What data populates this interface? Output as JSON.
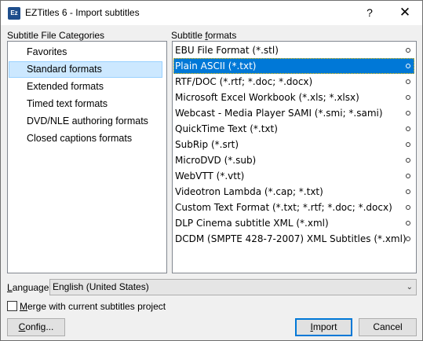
{
  "window": {
    "title": "EZTitles 6 - Import subtitles",
    "icon_text": "Ez",
    "help_glyph": "?",
    "close_glyph": "✕"
  },
  "categories": {
    "label_pre": "",
    "label_u": "",
    "label_post": "Subtitle File Categories",
    "items": [
      {
        "label": "Favorites"
      },
      {
        "label": "Standard formats"
      },
      {
        "label": "Extended formats"
      },
      {
        "label": "Timed text formats"
      },
      {
        "label": "DVD/NLE authoring formats"
      },
      {
        "label": "Closed captions formats"
      }
    ],
    "selected_index": 1
  },
  "formats": {
    "label_pre": "Subtitle ",
    "label_u": "f",
    "label_post": "ormats",
    "items": [
      {
        "label": "EBU File Format  (*.stl)"
      },
      {
        "label": "Plain ASCII  (*.txt)"
      },
      {
        "label": "RTF/DOC  (*.rtf; *.doc; *.docx)"
      },
      {
        "label": "Microsoft Excel Workbook  (*.xls; *.xlsx)"
      },
      {
        "label": "Webcast - Media Player SAMI  (*.smi; *.sami)"
      },
      {
        "label": "QuickTime Text  (*.txt)"
      },
      {
        "label": "SubRip  (*.srt)"
      },
      {
        "label": "MicroDVD  (*.sub)"
      },
      {
        "label": "WebVTT  (*.vtt)"
      },
      {
        "label": "Videotron Lambda  (*.cap; *.txt)"
      },
      {
        "label": "Custom Text Format  (*.txt; *.rtf; *.doc; *.docx)"
      },
      {
        "label": "DLP Cinema subtitle XML  (*.xml)"
      },
      {
        "label": "DCDM (SMPTE 428-7-2007) XML Subtitles  (*.xml)"
      }
    ],
    "selected_index": 1
  },
  "language": {
    "label_u": "L",
    "label_post": "anguage:",
    "value": "English (United States)",
    "arrow_glyph": "⌄"
  },
  "merge": {
    "label_u": "M",
    "label_post": "erge with current subtitles project",
    "checked": false
  },
  "buttons": {
    "config_u": "C",
    "config_post": "onfig...",
    "import_u": "I",
    "import_post": "mport",
    "cancel": "Cancel"
  }
}
